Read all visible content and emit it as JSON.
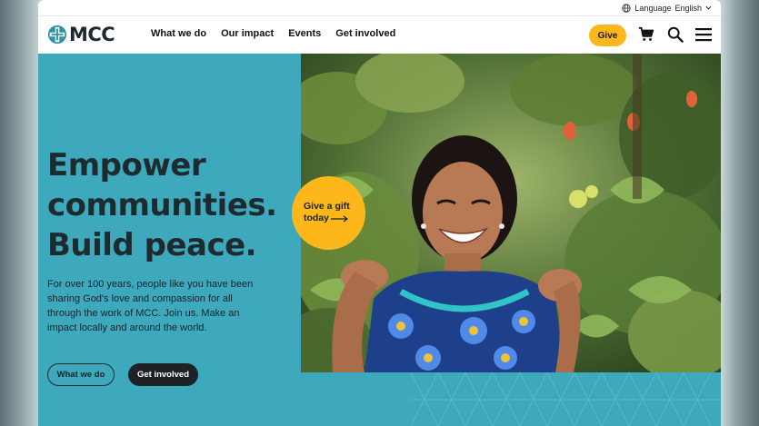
{
  "utility": {
    "language_label": "Language",
    "language_value": "English"
  },
  "brand": {
    "name": "MCC"
  },
  "nav": {
    "links": [
      "What we do",
      "Our impact",
      "Events",
      "Get involved"
    ],
    "give_label": "Give"
  },
  "hero": {
    "headline": [
      "Empower",
      "communities.",
      "Build peace."
    ],
    "intro": "For over 100 years, people like you have been sharing God's love and compassion for all through the work of MCC. Join us. Make an impact locally and around the world.",
    "primary_button": "What we do",
    "secondary_button": "Get involved",
    "gift_cta_line1": "Give a gift",
    "gift_cta_line2": "today"
  },
  "colors": {
    "brand_teal": "#3ea9bd",
    "accent_yellow": "#fdb71a",
    "dark": "#1c2225"
  },
  "icons": [
    "globe-icon",
    "chevron-down-icon",
    "cart-icon",
    "search-icon",
    "menu-icon",
    "arrow-right-icon"
  ]
}
